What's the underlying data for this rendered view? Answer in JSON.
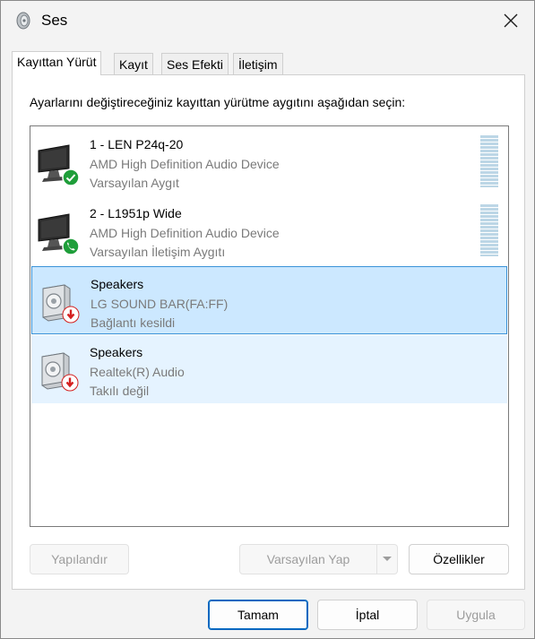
{
  "window": {
    "title": "Ses",
    "icon": "speaker-icon"
  },
  "tabs": [
    {
      "label": "Kayıttan Yürüt",
      "active": true
    },
    {
      "label": "Kayıt",
      "active": false
    },
    {
      "label": "Ses Efekti",
      "active": false
    },
    {
      "label": "İletişim",
      "active": false
    }
  ],
  "instruction": "Ayarlarını değiştireceğiniz kayıttan yürütme aygıtını aşağıdan seçin:",
  "devices": [
    {
      "name": "1 - LEN P24q-20",
      "description": "AMD High Definition Audio Device",
      "status": "Varsayılan Aygıt",
      "icon": "monitor-icon",
      "badge": "default-check-icon",
      "selected": false
    },
    {
      "name": "2 - L1951p Wide",
      "description": "AMD High Definition Audio Device",
      "status": "Varsayılan İletişim Aygıtı",
      "icon": "monitor-icon",
      "badge": "phone-icon",
      "selected": false
    },
    {
      "name": "Speakers",
      "description": "LG SOUND BAR(FA:FF)",
      "status": "Bağlantı kesildi",
      "icon": "speaker-icon",
      "badge": "down-arrow-icon",
      "selected": true
    },
    {
      "name": "Speakers",
      "description": "Realtek(R) Audio",
      "status": "Takılı değil",
      "icon": "speaker-icon",
      "badge": "down-arrow-icon",
      "selected": false
    }
  ],
  "buttons": {
    "configure": "Yapılandır",
    "set_default": "Varsayılan Yap",
    "properties": "Özellikler",
    "ok": "Tamam",
    "cancel": "İptal",
    "apply": "Uygula"
  },
  "colors": {
    "selection_bg": "#cce8ff",
    "selection_border": "#3b93d8",
    "hover_bg": "#e5f3ff",
    "default_badge": "#1f9e3a",
    "disconnected_badge": "#d42020",
    "primary_accent": "#0067c0"
  }
}
